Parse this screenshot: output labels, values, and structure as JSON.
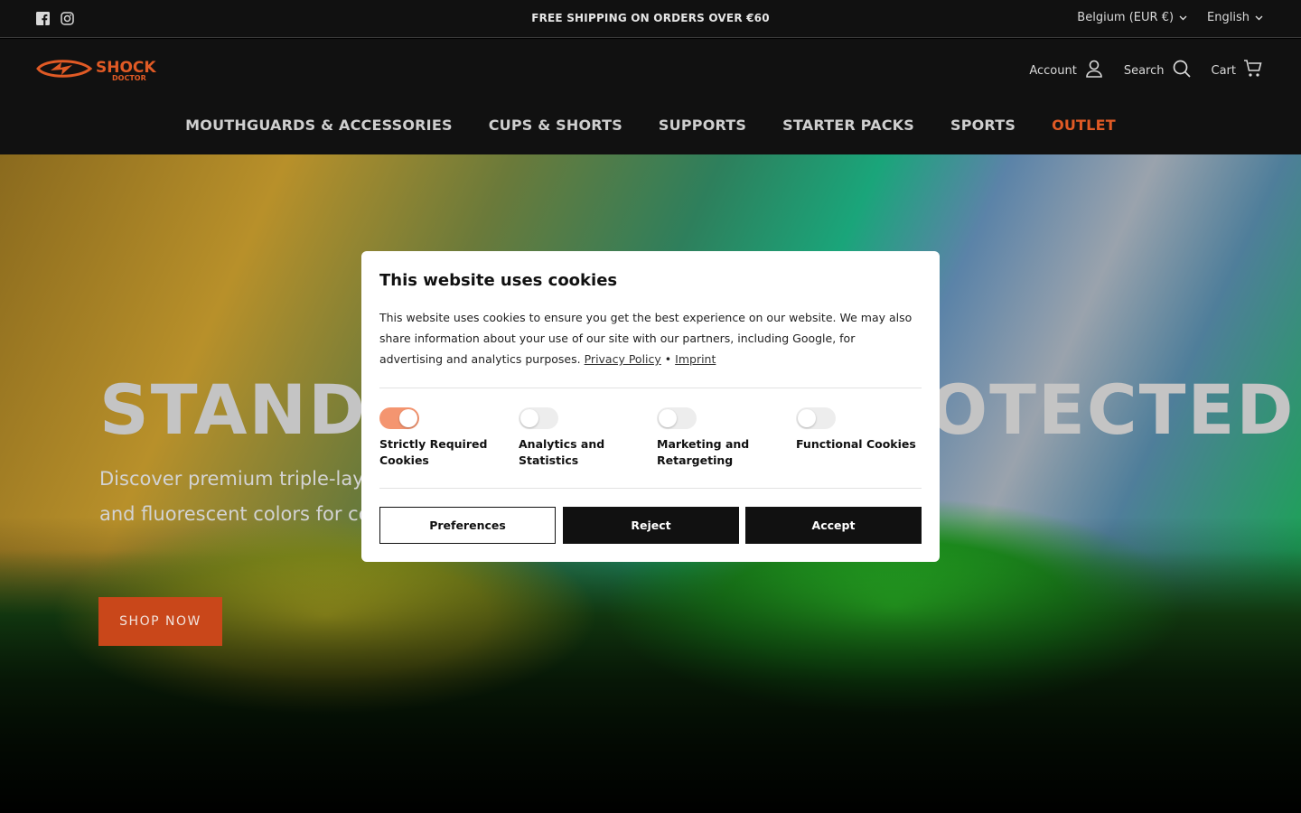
{
  "topbar": {
    "announcement": "FREE SHIPPING ON ORDERS OVER €60",
    "country": "Belgium (EUR €)",
    "language": "English"
  },
  "header": {
    "logo_text_top": "SHOCK",
    "logo_text_bottom": "DOCTOR",
    "account_label": "Account",
    "search_label": "Search",
    "cart_label": "Cart"
  },
  "nav": {
    "items": [
      "MOUTHGUARDS & ACCESSORIES",
      "CUPS & SHORTS",
      "SUPPORTS",
      "STARTER PACKS",
      "SPORTS",
      "OUTLET"
    ]
  },
  "hero": {
    "headline": "STAND OUT. STAY PROTECTED.",
    "subtitle": "Discover premium triple-layer mouthguards with breathing channels and fluorescent colors for contact sports.",
    "cta_label": "SHOP NOW"
  },
  "cookie_modal": {
    "title": "This website uses cookies",
    "body": "This website uses cookies to ensure you get the best experience on our website. We may also share information about your use of our site with our partners, including Google, for advertising and analytics purposes.",
    "privacy_link": "Privacy Policy",
    "separator": "•",
    "imprint_link": "Imprint",
    "toggles": [
      {
        "label": "Strictly Required Cookies",
        "on": true
      },
      {
        "label": "Analytics and Statistics",
        "on": false
      },
      {
        "label": "Marketing and Retargeting",
        "on": false
      },
      {
        "label": "Functional Cookies",
        "on": false
      }
    ],
    "preferences_label": "Preferences",
    "reject_label": "Reject",
    "accept_label": "Accept"
  },
  "colors": {
    "brand_orange": "#e05a25",
    "cta_orange": "#c9471a",
    "toggle_on": "#f49570",
    "header_bg": "#111111"
  },
  "icons": [
    "facebook-icon",
    "instagram-icon",
    "chevron-down-icon",
    "user-icon",
    "search-icon",
    "cart-icon"
  ]
}
